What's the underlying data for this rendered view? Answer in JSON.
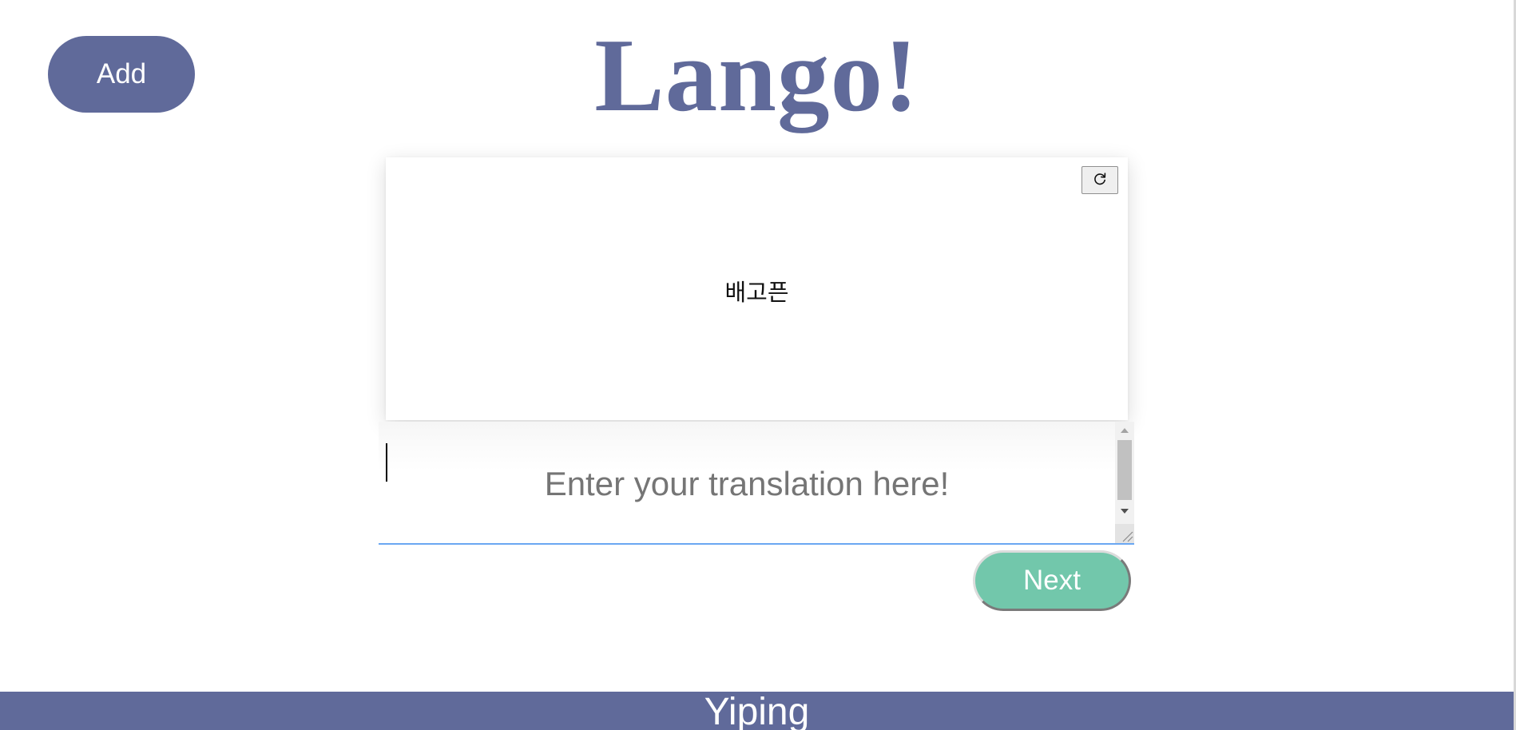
{
  "header": {
    "add_label": "Add",
    "title": "Lango!"
  },
  "card": {
    "word": "배고픈",
    "refresh_icon": "refresh-icon"
  },
  "translation": {
    "value": "",
    "placeholder": "Enter your translation here!"
  },
  "actions": {
    "next_label": "Next"
  },
  "footer": {
    "text": "Yiping"
  },
  "colors": {
    "brand": "#606a9a",
    "accent": "#72c7ab",
    "focus_underline": "#6aa7f2",
    "background": "#ffffff"
  }
}
